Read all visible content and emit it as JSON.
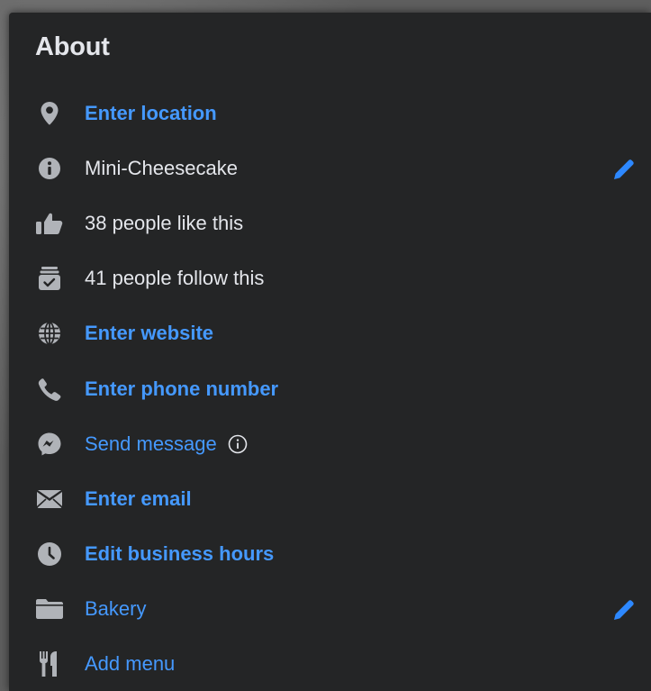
{
  "about": {
    "title": "About",
    "items": [
      {
        "icon": "location-pin-icon",
        "label": "Enter location"
      },
      {
        "icon": "info-icon",
        "label": "Mini-Cheesecake"
      },
      {
        "icon": "thumbs-up-icon",
        "label": "38 people like this"
      },
      {
        "icon": "follow-box-icon",
        "label": "41 people follow this"
      },
      {
        "icon": "globe-icon",
        "label": "Enter website"
      },
      {
        "icon": "phone-icon",
        "label": "Enter phone number"
      },
      {
        "icon": "messenger-icon",
        "label": "Send message"
      },
      {
        "icon": "envelope-icon",
        "label": "Enter email"
      },
      {
        "icon": "clock-icon",
        "label": "Edit business hours"
      },
      {
        "icon": "folder-icon",
        "label": "Bakery"
      },
      {
        "icon": "fork-knife-icon",
        "label": "Add menu"
      }
    ]
  },
  "colors": {
    "background": "#242526",
    "text": "#e4e6eb",
    "link": "#4599ff",
    "icon": "#b0b3b8"
  }
}
